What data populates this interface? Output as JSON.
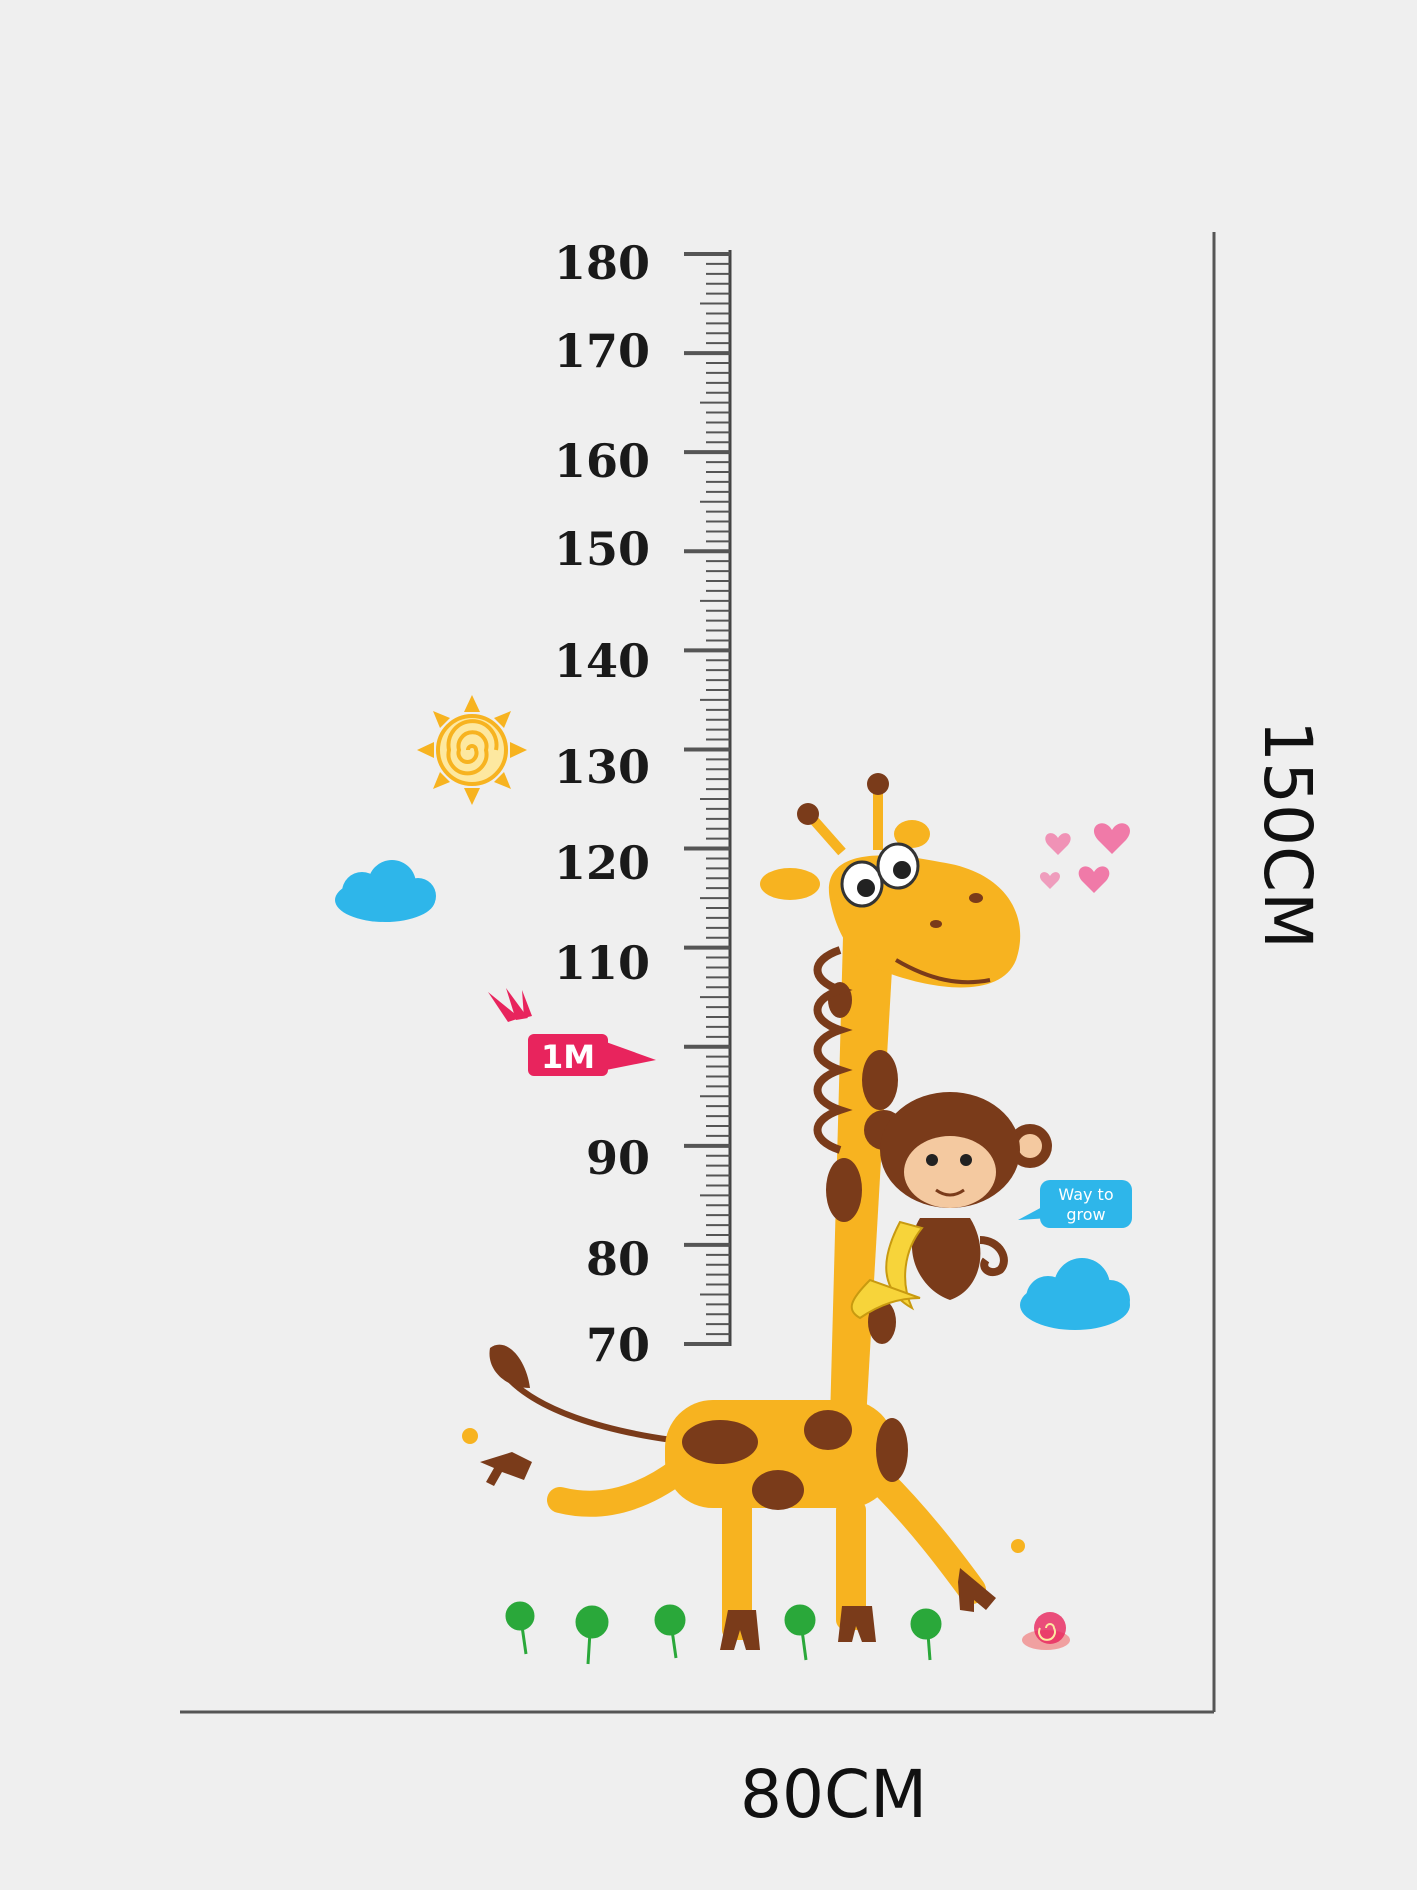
{
  "ruler": {
    "labels": [
      "180",
      "170",
      "160",
      "150",
      "140",
      "130",
      "120",
      "110",
      "90",
      "80",
      "70"
    ]
  },
  "sign_1m": "1M",
  "bubble": {
    "line1": "Way to",
    "line2": "grow"
  },
  "dimensions": {
    "width": "80CM",
    "height": "150CM"
  },
  "colors": {
    "background": "#efefef",
    "giraffe": "#f7b320",
    "spots": "#7a3b1a",
    "cloud": "#2eb6ea",
    "sign": "#e8245d",
    "sun": "#f7b320",
    "hearts": "#f07aa8",
    "grass": "#2aa83a"
  },
  "icons": [
    "sun-icon",
    "cloud-icon",
    "heart-icon",
    "giraffe-illustration",
    "monkey-illustration",
    "banana-icon",
    "grass-icon",
    "snail-icon"
  ]
}
